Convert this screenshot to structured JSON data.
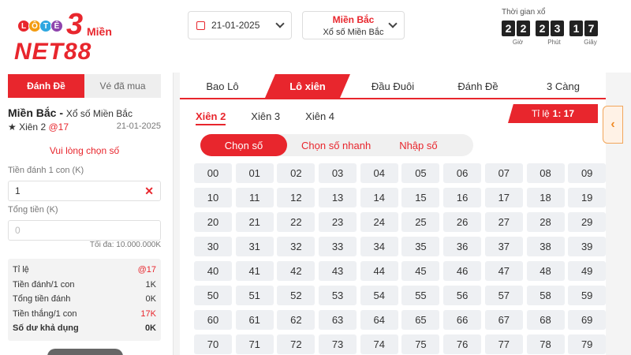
{
  "logo": {
    "balls": [
      "L",
      "Ô",
      "T",
      "Ê"
    ],
    "ball_colors": [
      "#e8262d",
      "#f39c12",
      "#2ea7e0",
      "#8e44ad"
    ],
    "number": "3",
    "mien": "Miền",
    "brand": "NET88"
  },
  "header": {
    "date": "21-01-2025",
    "region_title": "Miền Bắc",
    "region_sub": "Xổ số Miền Bắc",
    "timer_label": "Thời gian xổ",
    "hours": [
      "2",
      "2"
    ],
    "minutes": [
      "2",
      "3"
    ],
    "seconds": [
      "1",
      "7"
    ],
    "unit_hour": "Giờ",
    "unit_min": "Phút",
    "unit_sec": "Giây"
  },
  "left": {
    "tab_bet": "Đánh Đề",
    "tab_bought": "Vé đã mua",
    "title": "Miền Bắc -",
    "title_sub": "Xổ số Miền Bắc",
    "bet_type": "★ Xiên 2",
    "bet_rate": "@17",
    "date": "21-01-2025",
    "please_choose": "Vui lòng chọn số",
    "label_per_unit": "Tiền đánh 1 con (K)",
    "value_per_unit": "1",
    "label_total": "Tổng tiền (K)",
    "total_placeholder": "0",
    "max": "Tối đa: 10.000.000K",
    "summary": {
      "ratio_label": "Tỉ lệ",
      "ratio_value": "@17",
      "per_unit_label": "Tiền đánh/1 con",
      "per_unit_value": "1K",
      "total_label": "Tổng tiền đánh",
      "total_value": "0K",
      "win_label": "Tiền thắng/1 con",
      "win_value": "17K",
      "balance_label": "Số dư khả dụng",
      "balance_value": "0K"
    }
  },
  "main": {
    "nav": [
      "Bao Lô",
      "Lô xiên",
      "Đầu Đuôi",
      "Đánh Đề",
      "3 Càng"
    ],
    "subtabs": [
      "Xiên 2",
      "Xiên 3",
      "Xiên 4"
    ],
    "ratio_label": "Tỉ lệ",
    "ratio_value": "1: 17",
    "modes": [
      "Chọn số",
      "Chọn số nhanh",
      "Nhập số"
    ],
    "numbers": [
      "00",
      "01",
      "02",
      "03",
      "04",
      "05",
      "06",
      "07",
      "08",
      "09",
      "10",
      "11",
      "12",
      "13",
      "14",
      "15",
      "16",
      "17",
      "18",
      "19",
      "20",
      "21",
      "22",
      "23",
      "24",
      "25",
      "26",
      "27",
      "28",
      "29",
      "30",
      "31",
      "32",
      "33",
      "34",
      "35",
      "36",
      "37",
      "38",
      "39",
      "40",
      "41",
      "42",
      "43",
      "44",
      "45",
      "46",
      "47",
      "48",
      "49",
      "50",
      "51",
      "52",
      "53",
      "54",
      "55",
      "56",
      "57",
      "58",
      "59",
      "60",
      "61",
      "62",
      "63",
      "64",
      "65",
      "66",
      "67",
      "68",
      "69",
      "70",
      "71",
      "72",
      "73",
      "74",
      "75",
      "76",
      "77",
      "78",
      "79"
    ]
  },
  "colors": {
    "accent": "#e8262d",
    "handle": "#f08a24"
  }
}
